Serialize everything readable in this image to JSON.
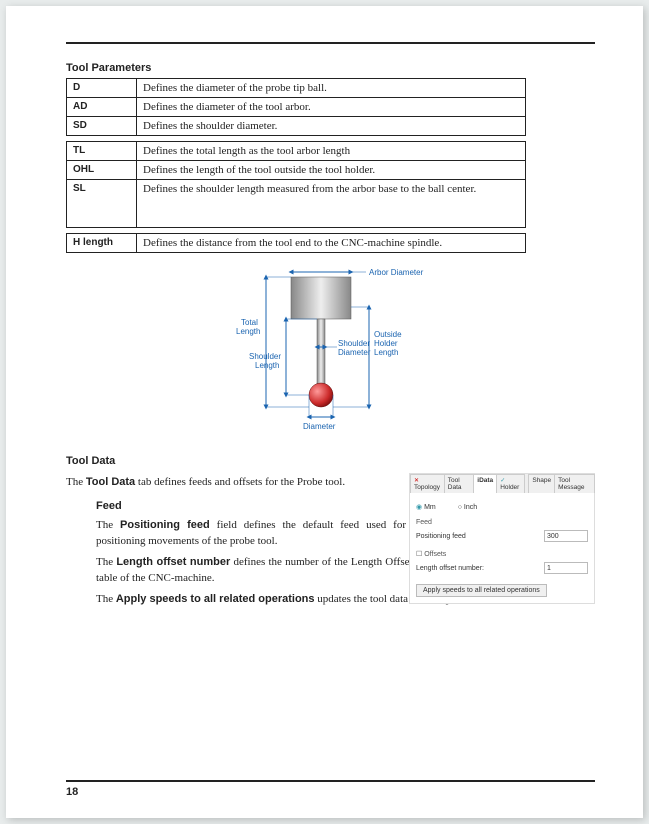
{
  "sections": {
    "params_title": "Tool Parameters",
    "data_title": "Tool Data"
  },
  "table": [
    {
      "param": "D",
      "desc": "Defines the diameter of the probe tip ball."
    },
    {
      "param": "AD",
      "desc": "Defines the diameter of the tool arbor."
    },
    {
      "param": "SD",
      "desc": "Defines the shoulder diameter."
    },
    {
      "param": "TL",
      "desc": "Defines the total length as the tool arbor length"
    },
    {
      "param": "OHL",
      "desc": "Defines the length of the tool outside the tool holder."
    },
    {
      "param": "SL",
      "desc": "Defines the shoulder length measured from the arbor base to the ball center."
    },
    {
      "param": "H length",
      "desc": "Defines the distance from the tool end to the CNC-machine spindle."
    }
  ],
  "diagram": {
    "arbor_diameter": "Arbor Diameter",
    "total_length": "Total\nLength",
    "shoulder_length": "Shoulder\nLength",
    "shoulder_diameter": "Shoulder\nDiameter",
    "ohl": "Outside\nHolder\nLength",
    "diameter": "Diameter"
  },
  "tooldata": {
    "intro_pre": "The ",
    "intro_bold": "Tool Data",
    "intro_post": " tab defines feeds and offsets for the Probe tool.",
    "feed_title": "Feed",
    "feed_text_pre": "The ",
    "feed_bold": "Positioning feed",
    "feed_text_post": " field defines the default feed used for positioning movements of the probe tool.",
    "offset_pre": "The ",
    "offset_bold": "Length offset number",
    "offset_post": " defines the number of the Length Offset Register of the current tool in the Offset table of the CNC-machine.",
    "apply_pre": "The ",
    "apply_bold": "Apply speeds to all related operations",
    "apply_post": " updates the tool data for all operations."
  },
  "gui": {
    "tabs": [
      "Topology",
      "Tool Data",
      "iData",
      "Holder",
      "Shape",
      "Tool Message"
    ],
    "unit_mm": "Mm",
    "unit_inch": "Inch",
    "group_feed": "Feed",
    "pos_feed_label": "Positioning feed",
    "pos_feed_value": "300",
    "group_offsets": "Offsets",
    "len_off_label": "Length offset number:",
    "len_off_value": "1",
    "apply_button": "Apply speeds to all related operations"
  },
  "page_number": "18"
}
